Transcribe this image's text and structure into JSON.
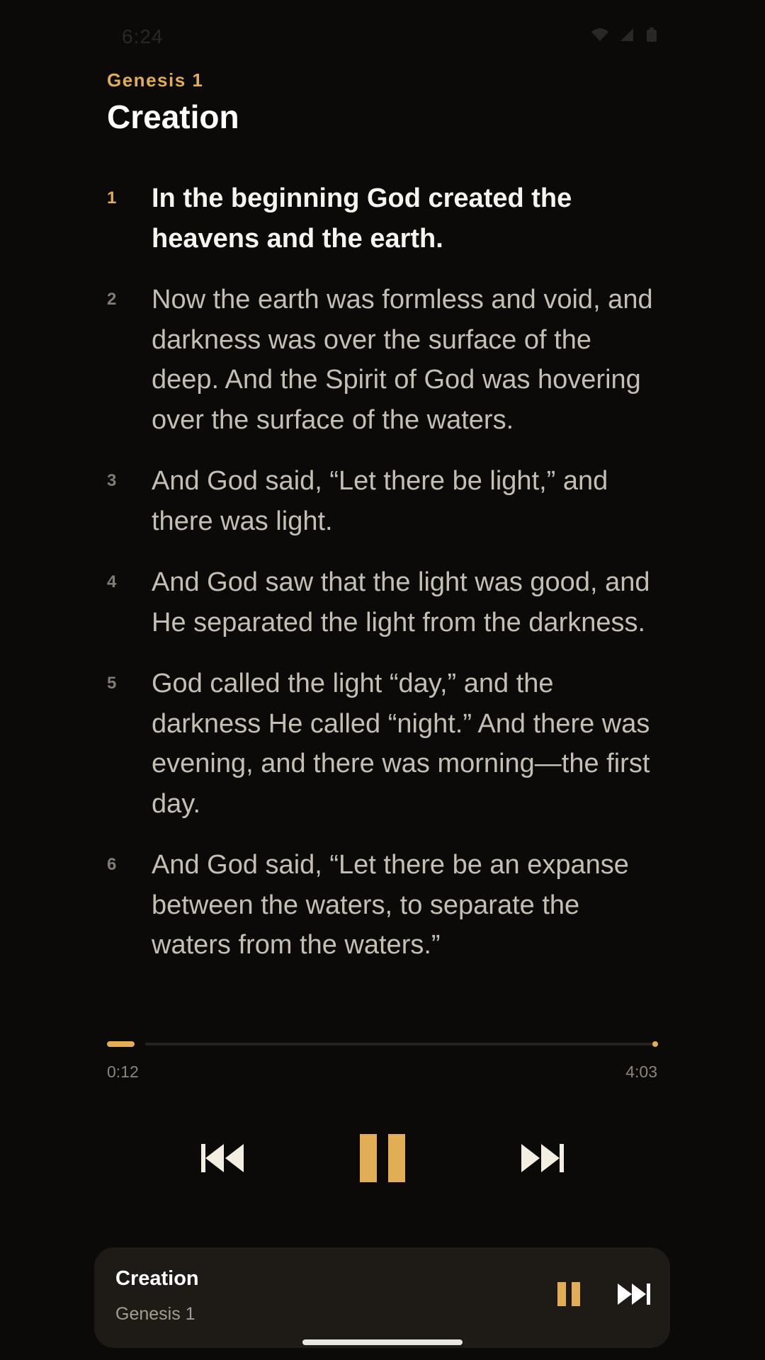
{
  "status_bar": {
    "time": "6:24"
  },
  "header": {
    "book_ref": "Genesis 1",
    "title": "Creation"
  },
  "verses": [
    {
      "num": "1",
      "text": "In the beginning God created the heavens and the earth.",
      "active": true
    },
    {
      "num": "2",
      "text": "Now the earth was formless and void, and darkness was over the surface of the deep. And the Spirit of God was hovering over the surface of the waters."
    },
    {
      "num": "3",
      "text": "And God said, “Let there be light,” and there was light."
    },
    {
      "num": "4",
      "text": "And God saw that the light was good, and He separated the light from the darkness."
    },
    {
      "num": "5",
      "text": "God called the light “day,” and the darkness He called “night.” And there was evening, and there was morning—the first day."
    },
    {
      "num": "6",
      "text": "And God said, “Let there be an expanse between the waters, to separate the waters from the waters.”"
    }
  ],
  "player": {
    "current_time": "0:12",
    "total_time": "4:03",
    "progress": 0.05,
    "controls": [
      "skip-previous-icon",
      "pause-icon",
      "skip-next-icon"
    ]
  },
  "mini_player": {
    "title": "Creation",
    "subtitle": "Genesis 1"
  },
  "colors": {
    "background": "#0b0a08",
    "accent": "#e2ae55",
    "text_active": "#f6f4ef",
    "text": "#c5bfb3",
    "mini_player_bg": "#1e1a16"
  }
}
